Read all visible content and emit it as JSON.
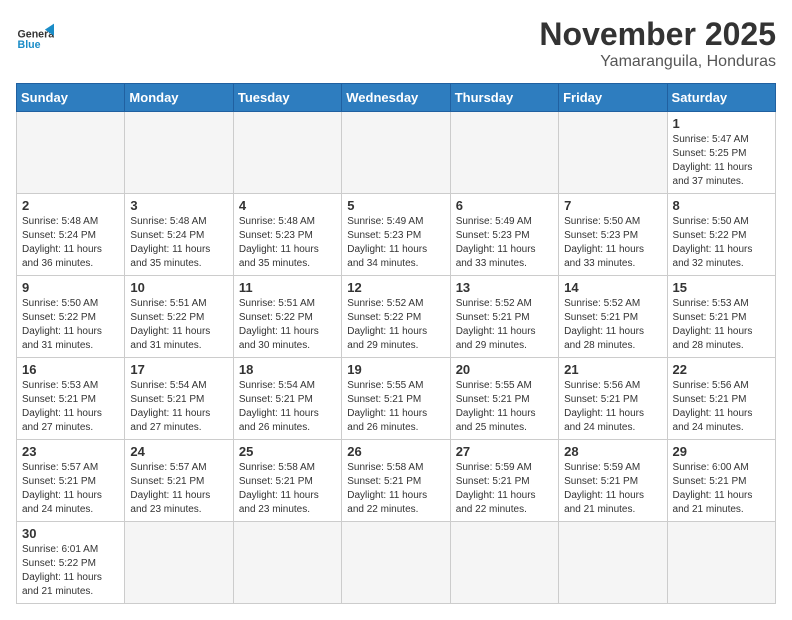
{
  "header": {
    "logo_general": "General",
    "logo_blue": "Blue",
    "month_title": "November 2025",
    "location": "Yamaranguila, Honduras"
  },
  "weekdays": [
    "Sunday",
    "Monday",
    "Tuesday",
    "Wednesday",
    "Thursday",
    "Friday",
    "Saturday"
  ],
  "days": [
    {
      "num": "",
      "sunrise": "",
      "sunset": "",
      "daylight": "",
      "empty": true
    },
    {
      "num": "",
      "sunrise": "",
      "sunset": "",
      "daylight": "",
      "empty": true
    },
    {
      "num": "",
      "sunrise": "",
      "sunset": "",
      "daylight": "",
      "empty": true
    },
    {
      "num": "",
      "sunrise": "",
      "sunset": "",
      "daylight": "",
      "empty": true
    },
    {
      "num": "",
      "sunrise": "",
      "sunset": "",
      "daylight": "",
      "empty": true
    },
    {
      "num": "",
      "sunrise": "",
      "sunset": "",
      "daylight": "",
      "empty": true
    },
    {
      "num": "1",
      "sunrise": "Sunrise: 5:47 AM",
      "sunset": "Sunset: 5:25 PM",
      "daylight": "Daylight: 11 hours and 37 minutes.",
      "empty": false
    },
    {
      "num": "2",
      "sunrise": "Sunrise: 5:48 AM",
      "sunset": "Sunset: 5:24 PM",
      "daylight": "Daylight: 11 hours and 36 minutes.",
      "empty": false
    },
    {
      "num": "3",
      "sunrise": "Sunrise: 5:48 AM",
      "sunset": "Sunset: 5:24 PM",
      "daylight": "Daylight: 11 hours and 35 minutes.",
      "empty": false
    },
    {
      "num": "4",
      "sunrise": "Sunrise: 5:48 AM",
      "sunset": "Sunset: 5:23 PM",
      "daylight": "Daylight: 11 hours and 35 minutes.",
      "empty": false
    },
    {
      "num": "5",
      "sunrise": "Sunrise: 5:49 AM",
      "sunset": "Sunset: 5:23 PM",
      "daylight": "Daylight: 11 hours and 34 minutes.",
      "empty": false
    },
    {
      "num": "6",
      "sunrise": "Sunrise: 5:49 AM",
      "sunset": "Sunset: 5:23 PM",
      "daylight": "Daylight: 11 hours and 33 minutes.",
      "empty": false
    },
    {
      "num": "7",
      "sunrise": "Sunrise: 5:50 AM",
      "sunset": "Sunset: 5:23 PM",
      "daylight": "Daylight: 11 hours and 33 minutes.",
      "empty": false
    },
    {
      "num": "8",
      "sunrise": "Sunrise: 5:50 AM",
      "sunset": "Sunset: 5:22 PM",
      "daylight": "Daylight: 11 hours and 32 minutes.",
      "empty": false
    },
    {
      "num": "9",
      "sunrise": "Sunrise: 5:50 AM",
      "sunset": "Sunset: 5:22 PM",
      "daylight": "Daylight: 11 hours and 31 minutes.",
      "empty": false
    },
    {
      "num": "10",
      "sunrise": "Sunrise: 5:51 AM",
      "sunset": "Sunset: 5:22 PM",
      "daylight": "Daylight: 11 hours and 31 minutes.",
      "empty": false
    },
    {
      "num": "11",
      "sunrise": "Sunrise: 5:51 AM",
      "sunset": "Sunset: 5:22 PM",
      "daylight": "Daylight: 11 hours and 30 minutes.",
      "empty": false
    },
    {
      "num": "12",
      "sunrise": "Sunrise: 5:52 AM",
      "sunset": "Sunset: 5:22 PM",
      "daylight": "Daylight: 11 hours and 29 minutes.",
      "empty": false
    },
    {
      "num": "13",
      "sunrise": "Sunrise: 5:52 AM",
      "sunset": "Sunset: 5:21 PM",
      "daylight": "Daylight: 11 hours and 29 minutes.",
      "empty": false
    },
    {
      "num": "14",
      "sunrise": "Sunrise: 5:52 AM",
      "sunset": "Sunset: 5:21 PM",
      "daylight": "Daylight: 11 hours and 28 minutes.",
      "empty": false
    },
    {
      "num": "15",
      "sunrise": "Sunrise: 5:53 AM",
      "sunset": "Sunset: 5:21 PM",
      "daylight": "Daylight: 11 hours and 28 minutes.",
      "empty": false
    },
    {
      "num": "16",
      "sunrise": "Sunrise: 5:53 AM",
      "sunset": "Sunset: 5:21 PM",
      "daylight": "Daylight: 11 hours and 27 minutes.",
      "empty": false
    },
    {
      "num": "17",
      "sunrise": "Sunrise: 5:54 AM",
      "sunset": "Sunset: 5:21 PM",
      "daylight": "Daylight: 11 hours and 27 minutes.",
      "empty": false
    },
    {
      "num": "18",
      "sunrise": "Sunrise: 5:54 AM",
      "sunset": "Sunset: 5:21 PM",
      "daylight": "Daylight: 11 hours and 26 minutes.",
      "empty": false
    },
    {
      "num": "19",
      "sunrise": "Sunrise: 5:55 AM",
      "sunset": "Sunset: 5:21 PM",
      "daylight": "Daylight: 11 hours and 26 minutes.",
      "empty": false
    },
    {
      "num": "20",
      "sunrise": "Sunrise: 5:55 AM",
      "sunset": "Sunset: 5:21 PM",
      "daylight": "Daylight: 11 hours and 25 minutes.",
      "empty": false
    },
    {
      "num": "21",
      "sunrise": "Sunrise: 5:56 AM",
      "sunset": "Sunset: 5:21 PM",
      "daylight": "Daylight: 11 hours and 24 minutes.",
      "empty": false
    },
    {
      "num": "22",
      "sunrise": "Sunrise: 5:56 AM",
      "sunset": "Sunset: 5:21 PM",
      "daylight": "Daylight: 11 hours and 24 minutes.",
      "empty": false
    },
    {
      "num": "23",
      "sunrise": "Sunrise: 5:57 AM",
      "sunset": "Sunset: 5:21 PM",
      "daylight": "Daylight: 11 hours and 24 minutes.",
      "empty": false
    },
    {
      "num": "24",
      "sunrise": "Sunrise: 5:57 AM",
      "sunset": "Sunset: 5:21 PM",
      "daylight": "Daylight: 11 hours and 23 minutes.",
      "empty": false
    },
    {
      "num": "25",
      "sunrise": "Sunrise: 5:58 AM",
      "sunset": "Sunset: 5:21 PM",
      "daylight": "Daylight: 11 hours and 23 minutes.",
      "empty": false
    },
    {
      "num": "26",
      "sunrise": "Sunrise: 5:58 AM",
      "sunset": "Sunset: 5:21 PM",
      "daylight": "Daylight: 11 hours and 22 minutes.",
      "empty": false
    },
    {
      "num": "27",
      "sunrise": "Sunrise: 5:59 AM",
      "sunset": "Sunset: 5:21 PM",
      "daylight": "Daylight: 11 hours and 22 minutes.",
      "empty": false
    },
    {
      "num": "28",
      "sunrise": "Sunrise: 5:59 AM",
      "sunset": "Sunset: 5:21 PM",
      "daylight": "Daylight: 11 hours and 21 minutes.",
      "empty": false
    },
    {
      "num": "29",
      "sunrise": "Sunrise: 6:00 AM",
      "sunset": "Sunset: 5:21 PM",
      "daylight": "Daylight: 11 hours and 21 minutes.",
      "empty": false
    },
    {
      "num": "30",
      "sunrise": "Sunrise: 6:01 AM",
      "sunset": "Sunset: 5:22 PM",
      "daylight": "Daylight: 11 hours and 21 minutes.",
      "empty": false
    }
  ]
}
